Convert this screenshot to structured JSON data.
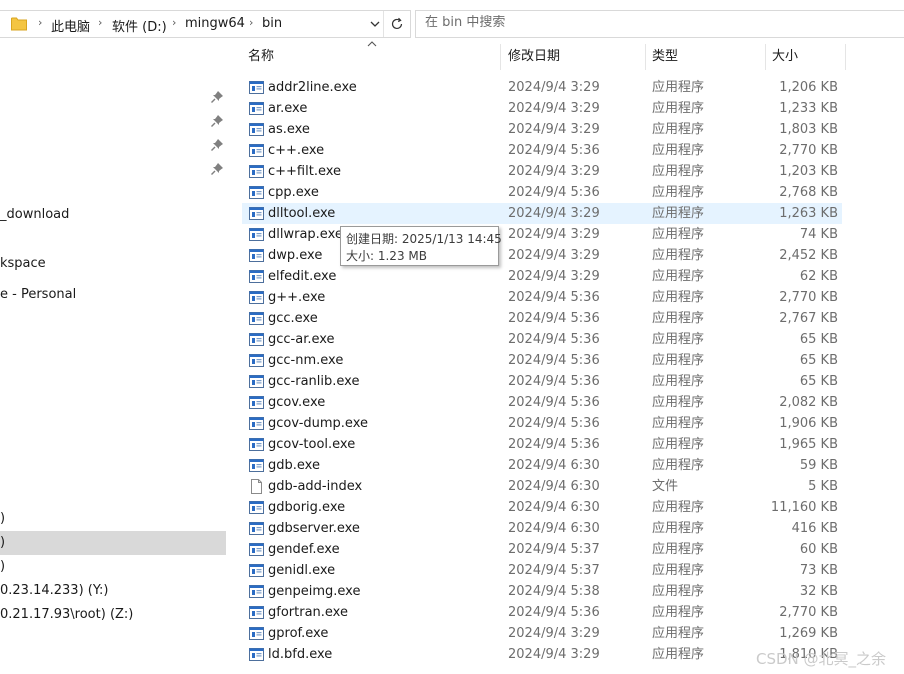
{
  "address": {
    "crumbs": [
      "此电脑",
      "软件 (D:)",
      "mingw64",
      "bin"
    ],
    "separator": "›"
  },
  "search": {
    "placeholder": "在 bin 中搜索"
  },
  "nav": {
    "items": [
      {
        "label": "_download",
        "selected": false
      },
      {
        "label": "kspace",
        "selected": false
      },
      {
        "label": "e - Personal",
        "selected": false
      },
      {
        "label": ")",
        "selected": false
      },
      {
        "label": ")",
        "selected": true
      },
      {
        "label": ")",
        "selected": false
      },
      {
        "label": "0.23.14.233) (Y:)",
        "selected": false
      },
      {
        "label": "0.21.17.93\\root) (Z:)",
        "selected": false
      }
    ]
  },
  "columns": {
    "name": "名称",
    "date": "修改日期",
    "type": "类型",
    "size": "大小"
  },
  "files": [
    {
      "name": "addr2line.exe",
      "date": "2024/9/4 3:29",
      "type": "应用程序",
      "size": "1,206 KB",
      "icon": "exe-icon"
    },
    {
      "name": "ar.exe",
      "date": "2024/9/4 3:29",
      "type": "应用程序",
      "size": "1,233 KB",
      "icon": "exe-icon"
    },
    {
      "name": "as.exe",
      "date": "2024/9/4 3:29",
      "type": "应用程序",
      "size": "1,803 KB",
      "icon": "exe-icon"
    },
    {
      "name": "c++.exe",
      "date": "2024/9/4 5:36",
      "type": "应用程序",
      "size": "2,770 KB",
      "icon": "exe-icon"
    },
    {
      "name": "c++filt.exe",
      "date": "2024/9/4 3:29",
      "type": "应用程序",
      "size": "1,203 KB",
      "icon": "exe-icon"
    },
    {
      "name": "cpp.exe",
      "date": "2024/9/4 5:36",
      "type": "应用程序",
      "size": "2,768 KB",
      "icon": "exe-icon"
    },
    {
      "name": "dlltool.exe",
      "date": "2024/9/4 3:29",
      "type": "应用程序",
      "size": "1,263 KB",
      "icon": "exe-icon",
      "hover": true
    },
    {
      "name": "dllwrap.exe",
      "date": "2024/9/4 3:29",
      "type": "应用程序",
      "size": "74 KB",
      "icon": "exe-icon"
    },
    {
      "name": "dwp.exe",
      "date": "2024/9/4 3:29",
      "type": "应用程序",
      "size": "2,452 KB",
      "icon": "exe-icon"
    },
    {
      "name": "elfedit.exe",
      "date": "2024/9/4 3:29",
      "type": "应用程序",
      "size": "62 KB",
      "icon": "exe-icon"
    },
    {
      "name": "g++.exe",
      "date": "2024/9/4 5:36",
      "type": "应用程序",
      "size": "2,770 KB",
      "icon": "exe-icon"
    },
    {
      "name": "gcc.exe",
      "date": "2024/9/4 5:36",
      "type": "应用程序",
      "size": "2,767 KB",
      "icon": "exe-icon"
    },
    {
      "name": "gcc-ar.exe",
      "date": "2024/9/4 5:36",
      "type": "应用程序",
      "size": "65 KB",
      "icon": "exe-icon"
    },
    {
      "name": "gcc-nm.exe",
      "date": "2024/9/4 5:36",
      "type": "应用程序",
      "size": "65 KB",
      "icon": "exe-icon"
    },
    {
      "name": "gcc-ranlib.exe",
      "date": "2024/9/4 5:36",
      "type": "应用程序",
      "size": "65 KB",
      "icon": "exe-icon"
    },
    {
      "name": "gcov.exe",
      "date": "2024/9/4 5:36",
      "type": "应用程序",
      "size": "2,082 KB",
      "icon": "exe-icon"
    },
    {
      "name": "gcov-dump.exe",
      "date": "2024/9/4 5:36",
      "type": "应用程序",
      "size": "1,906 KB",
      "icon": "exe-icon"
    },
    {
      "name": "gcov-tool.exe",
      "date": "2024/9/4 5:36",
      "type": "应用程序",
      "size": "1,965 KB",
      "icon": "exe-icon"
    },
    {
      "name": "gdb.exe",
      "date": "2024/9/4 6:30",
      "type": "应用程序",
      "size": "59 KB",
      "icon": "exe-icon"
    },
    {
      "name": "gdb-add-index",
      "date": "2024/9/4 6:30",
      "type": "文件",
      "size": "5 KB",
      "icon": "file-icon"
    },
    {
      "name": "gdborig.exe",
      "date": "2024/9/4 6:30",
      "type": "应用程序",
      "size": "11,160 KB",
      "icon": "exe-icon"
    },
    {
      "name": "gdbserver.exe",
      "date": "2024/9/4 6:30",
      "type": "应用程序",
      "size": "416 KB",
      "icon": "exe-icon"
    },
    {
      "name": "gendef.exe",
      "date": "2024/9/4 5:37",
      "type": "应用程序",
      "size": "60 KB",
      "icon": "exe-icon"
    },
    {
      "name": "genidl.exe",
      "date": "2024/9/4 5:37",
      "type": "应用程序",
      "size": "73 KB",
      "icon": "exe-icon"
    },
    {
      "name": "genpeimg.exe",
      "date": "2024/9/4 5:38",
      "type": "应用程序",
      "size": "32 KB",
      "icon": "exe-icon"
    },
    {
      "name": "gfortran.exe",
      "date": "2024/9/4 5:36",
      "type": "应用程序",
      "size": "2,770 KB",
      "icon": "exe-icon"
    },
    {
      "name": "gprof.exe",
      "date": "2024/9/4 3:29",
      "type": "应用程序",
      "size": "1,269 KB",
      "icon": "exe-icon"
    },
    {
      "name": "ld.bfd.exe",
      "date": "2024/9/4 3:29",
      "type": "应用程序",
      "size": "1,810 KB",
      "icon": "exe-icon"
    }
  ],
  "tooltip": {
    "created": "创建日期: 2025/1/13 14:45",
    "size": "大小: 1.23 MB"
  },
  "watermark": "CSDN @北冥_之余",
  "colors": {
    "hover_row": "#e5f3ff",
    "selected_nav": "#d9d9d9",
    "folder": "#f4c542",
    "exe_accent": "#2b6cc4"
  }
}
